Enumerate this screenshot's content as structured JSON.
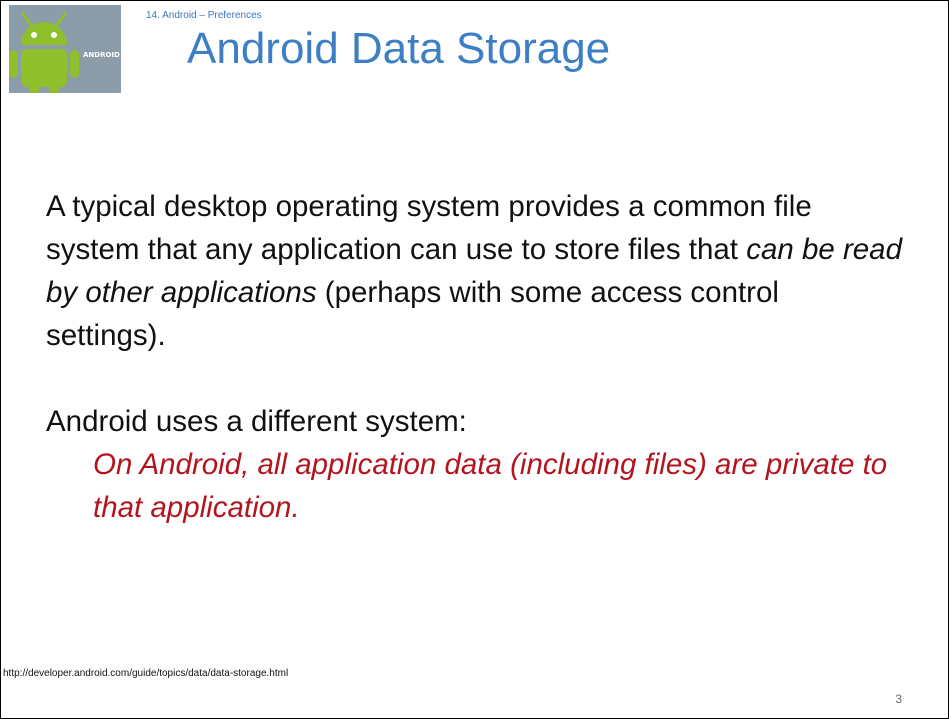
{
  "header": {
    "section_label": "14. Android – Preferences",
    "title": "Android Data Storage",
    "logo_icon": "android-robot-icon",
    "logo_text": "ANDROID"
  },
  "content": {
    "para1_part1": "A typical desktop operating system provides a common file system that any application can use to store files that ",
    "para1_emphasis": "can be read by other applications",
    "para1_part2": " (perhaps with some access control settings).",
    "para2": "Android uses a different system:",
    "quote": "On Android, all application data (including files) are private to that application."
  },
  "footer": {
    "url": "http://developer.android.com/guide/topics/data/data-storage.html",
    "page_number": "3"
  },
  "colors": {
    "title": "#3d7fc5",
    "section_label": "#3b78b8",
    "quote": "#b4141e",
    "android_green": "#8fc02c"
  }
}
